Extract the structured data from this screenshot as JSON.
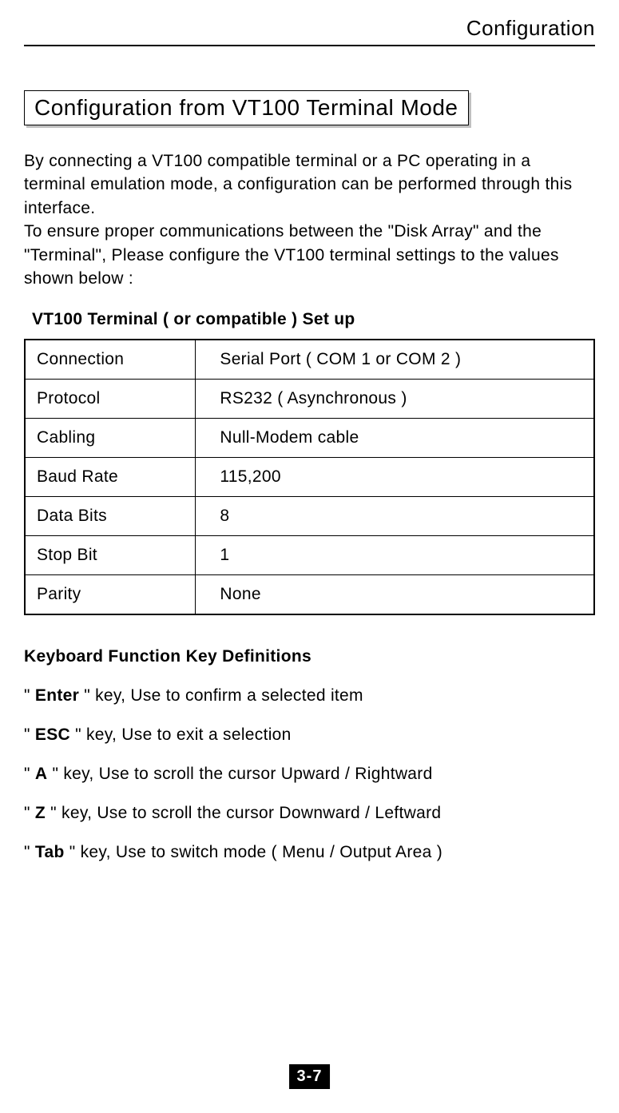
{
  "header": {
    "title": "Configuration"
  },
  "section": {
    "title": "Configuration from VT100 Terminal Mode",
    "intro": "By connecting a VT100 compatible terminal or a PC operating in a terminal emulation mode, a configuration can be performed through this interface.\nTo ensure proper communications between the \"Disk Array\" and the \"Terminal\", Please configure the VT100 terminal settings to the values shown below :"
  },
  "table": {
    "heading": "VT100 Terminal ( or compatible ) Set up",
    "rows": [
      {
        "label": "Connection",
        "value": "Serial Port  ( COM 1 or COM 2 )"
      },
      {
        "label": "Protocol",
        "value": "RS232  ( Asynchronous )"
      },
      {
        "label": "Cabling",
        "value": "Null-Modem cable"
      },
      {
        "label": "Baud Rate",
        "value": " 115,200"
      },
      {
        "label": "Data Bits",
        "value": " 8"
      },
      {
        "label": "Stop Bit",
        "value": " 1"
      },
      {
        "label": "Parity",
        "value": "  None"
      }
    ]
  },
  "keys": {
    "heading": "Keyboard Function Key Definitions",
    "items": [
      {
        "key": "Enter",
        "desc": " \" key, Use to confirm a selected item"
      },
      {
        "key": "ESC",
        "desc": " \" key, Use to exit a selection"
      },
      {
        "key": "A",
        "desc": " \" key, Use to scroll the cursor Upward / Rightward"
      },
      {
        "key": "Z",
        "desc": " \" key, Use to scroll the cursor Downward / Leftward"
      },
      {
        "key": "Tab",
        "desc": " \" key, Use to switch mode ( Menu / Output Area )"
      }
    ]
  },
  "page_number": "3-7"
}
